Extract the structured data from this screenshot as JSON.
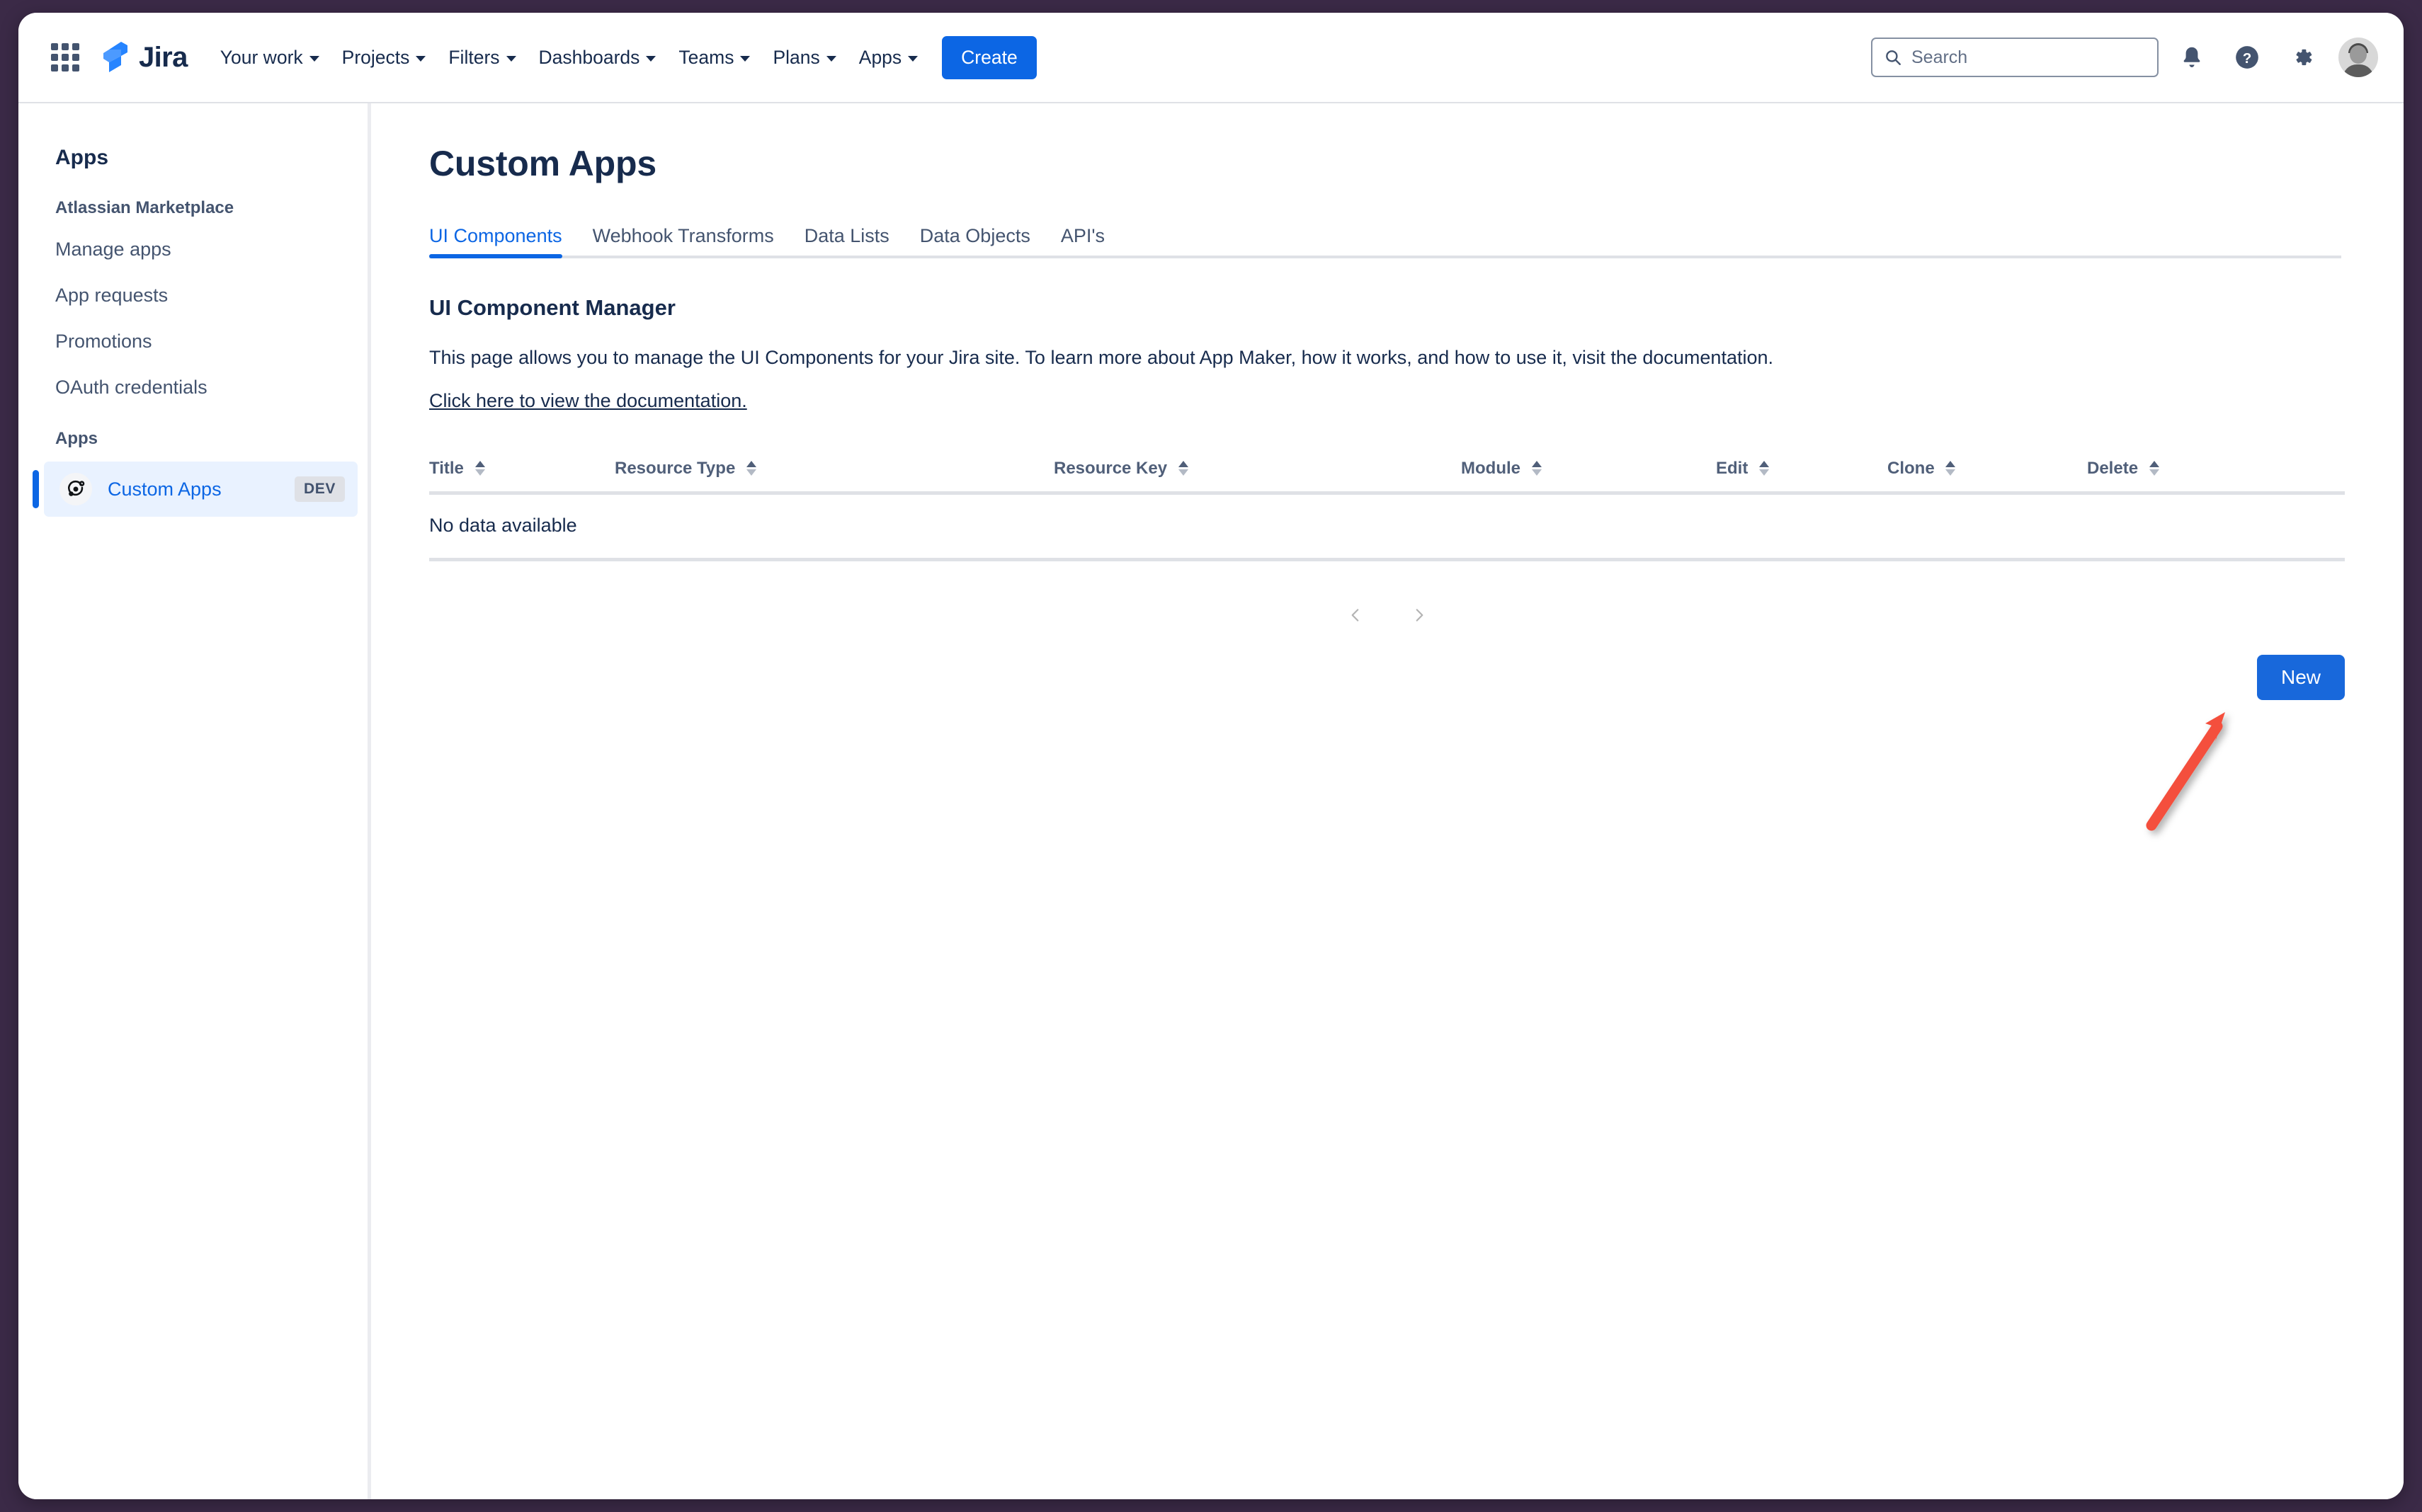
{
  "topnav": {
    "app_switcher_icon": "grid-apps-icon",
    "logo_text": "Jira",
    "items": [
      {
        "label": "Your work",
        "has_caret": true
      },
      {
        "label": "Projects",
        "has_caret": true
      },
      {
        "label": "Filters",
        "has_caret": true
      },
      {
        "label": "Dashboards",
        "has_caret": true
      },
      {
        "label": "Teams",
        "has_caret": true
      },
      {
        "label": "Plans",
        "has_caret": true
      },
      {
        "label": "Apps",
        "has_caret": true
      }
    ],
    "create_label": "Create",
    "search": {
      "placeholder": "Search",
      "value": "",
      "icon": "search-icon"
    },
    "notifications_icon": "bell-icon",
    "help_icon": "help-circle-icon",
    "settings_icon": "gear-icon",
    "avatar_icon": "user-avatar"
  },
  "sidebar": {
    "title": "Apps",
    "groups": [
      {
        "label": "Atlassian Marketplace",
        "links": [
          {
            "label": "Manage apps"
          },
          {
            "label": "App requests"
          },
          {
            "label": "Promotions"
          },
          {
            "label": "OAuth credentials"
          }
        ]
      }
    ],
    "apps_group_label": "Apps",
    "active_item": {
      "label": "Custom Apps",
      "badge": "DEV",
      "icon": "custom-apps-icon"
    }
  },
  "main": {
    "page_title": "Custom Apps",
    "tabs": [
      {
        "label": "UI Components",
        "active": true
      },
      {
        "label": "Webhook Transforms",
        "active": false
      },
      {
        "label": "Data Lists",
        "active": false
      },
      {
        "label": "Data Objects",
        "active": false
      },
      {
        "label": "API's",
        "active": false
      }
    ],
    "section_title": "UI Component Manager",
    "section_description": "This page allows you to manage the UI Components for your Jira site. To learn more about App Maker, how it works, and how to use it, visit the documentation.",
    "doc_link_label": "Click here to view the documentation.",
    "table": {
      "columns": [
        {
          "label": "Title",
          "sortable": true
        },
        {
          "label": "Resource Type",
          "sortable": true
        },
        {
          "label": "Resource Key",
          "sortable": true
        },
        {
          "label": "Module",
          "sortable": true
        },
        {
          "label": "Edit",
          "sortable": true
        },
        {
          "label": "Clone",
          "sortable": true
        },
        {
          "label": "Delete",
          "sortable": true
        }
      ],
      "rows": [],
      "empty_message": "No data available"
    },
    "pagination": {
      "prev_icon": "chevron-left-icon",
      "next_icon": "chevron-right-icon"
    },
    "new_button_label": "New"
  },
  "annotation": {
    "arrow_color": "#f4503c",
    "points_to": "New"
  },
  "colors": {
    "accent": "#0c66e4",
    "button_blue": "#1868db",
    "text": "#172b4d",
    "muted_text": "#44546f",
    "border": "#dfe1e6",
    "active_bg": "#e9f2ff",
    "window_frame": "#3b2a47",
    "annotation_red": "#f4503c"
  }
}
